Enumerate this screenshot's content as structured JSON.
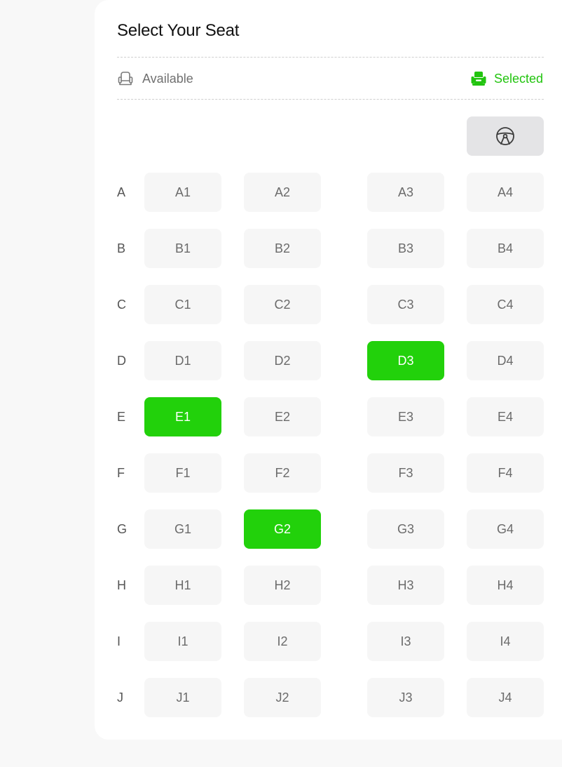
{
  "title": "Select Your Seat",
  "legend": {
    "available_label": "Available",
    "selected_label": "Selected",
    "available_icon": "seat-outline-icon",
    "selected_icon": "seat-filled-icon"
  },
  "driver_icon": "steering-wheel-icon",
  "colors": {
    "selected": "#22d10b",
    "selected_text": "#22c40f",
    "available_bg": "#f6f6f6",
    "driver_bg": "#e4e4e6"
  },
  "rows": [
    {
      "label": "A",
      "seats": [
        {
          "label": "A1",
          "selected": false
        },
        {
          "label": "A2",
          "selected": false
        },
        {
          "label": "A3",
          "selected": false
        },
        {
          "label": "A4",
          "selected": false
        }
      ]
    },
    {
      "label": "B",
      "seats": [
        {
          "label": "B1",
          "selected": false
        },
        {
          "label": "B2",
          "selected": false
        },
        {
          "label": "B3",
          "selected": false
        },
        {
          "label": "B4",
          "selected": false
        }
      ]
    },
    {
      "label": "C",
      "seats": [
        {
          "label": "C1",
          "selected": false
        },
        {
          "label": "C2",
          "selected": false
        },
        {
          "label": "C3",
          "selected": false
        },
        {
          "label": "C4",
          "selected": false
        }
      ]
    },
    {
      "label": "D",
      "seats": [
        {
          "label": "D1",
          "selected": false
        },
        {
          "label": "D2",
          "selected": false
        },
        {
          "label": "D3",
          "selected": true
        },
        {
          "label": "D4",
          "selected": false
        }
      ]
    },
    {
      "label": "E",
      "seats": [
        {
          "label": "E1",
          "selected": true
        },
        {
          "label": "E2",
          "selected": false
        },
        {
          "label": "E3",
          "selected": false
        },
        {
          "label": "E4",
          "selected": false
        }
      ]
    },
    {
      "label": "F",
      "seats": [
        {
          "label": "F1",
          "selected": false
        },
        {
          "label": "F2",
          "selected": false
        },
        {
          "label": "F3",
          "selected": false
        },
        {
          "label": "F4",
          "selected": false
        }
      ]
    },
    {
      "label": "G",
      "seats": [
        {
          "label": "G1",
          "selected": false
        },
        {
          "label": "G2",
          "selected": true
        },
        {
          "label": "G3",
          "selected": false
        },
        {
          "label": "G4",
          "selected": false
        }
      ]
    },
    {
      "label": "H",
      "seats": [
        {
          "label": "H1",
          "selected": false
        },
        {
          "label": "H2",
          "selected": false
        },
        {
          "label": "H3",
          "selected": false
        },
        {
          "label": "H4",
          "selected": false
        }
      ]
    },
    {
      "label": "I",
      "seats": [
        {
          "label": "I1",
          "selected": false
        },
        {
          "label": "I2",
          "selected": false
        },
        {
          "label": "I3",
          "selected": false
        },
        {
          "label": "I4",
          "selected": false
        }
      ]
    },
    {
      "label": "J",
      "seats": [
        {
          "label": "J1",
          "selected": false
        },
        {
          "label": "J2",
          "selected": false
        },
        {
          "label": "J3",
          "selected": false
        },
        {
          "label": "J4",
          "selected": false
        }
      ]
    }
  ]
}
